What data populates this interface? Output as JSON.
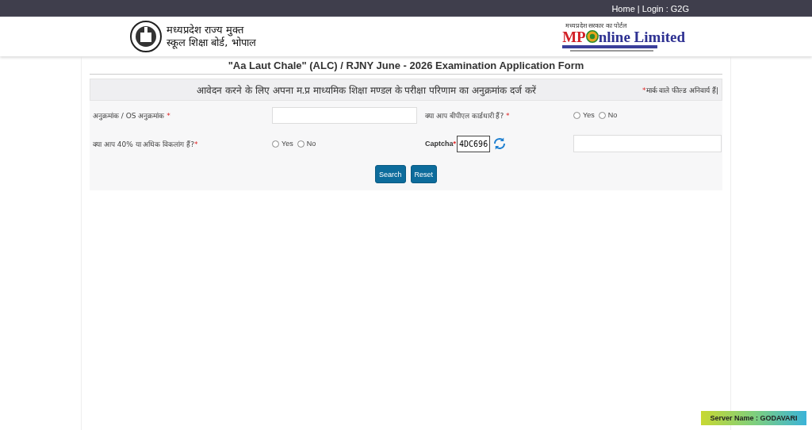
{
  "top_bar": {
    "links": [
      "Home |",
      "Login : G2G"
    ]
  },
  "header": {
    "board_name_line1": "मध्यप्रदेश राज्य मुक्त",
    "board_name_line2": "स्कूल शिक्षा बोर्ड, भोपाल",
    "portal_tagline": "मध्यप्रदेश सरकार का पोर्टल",
    "portal_name_start": "MP",
    "portal_name_end": "nline Limited"
  },
  "form": {
    "title": "\"Aa Laut Chale\" (ALC) / RJNY June - 2026 Examination Application Form",
    "instruction": "आवेदन करने के लिए अपना म.प्र माध्यमिक शिक्षा मण्डल के परीक्षा परिणाम का अनुक्रमांक दर्ज करें",
    "mandatory_note": "मार्क वाले फील्ड अनिवार्य हैं|",
    "roll_label": "अनुक्रमांक / OS अनुक्रमांक",
    "bpl_label": "क्या आप बीपीएल कार्डधारी हैं?",
    "bpl_options": [
      {
        "label": "Yes",
        "selected": false
      },
      {
        "label": "No",
        "selected": false
      }
    ],
    "disability_label": "क्या आप 40% या अधिक विकलांग हैं?",
    "disability_options": [
      {
        "label": "Yes",
        "selected": false
      },
      {
        "label": "No",
        "selected": false
      }
    ],
    "captcha_label": "Captcha",
    "captcha_code": "4DC696",
    "required_mark": "*",
    "buttons": [
      "Search",
      "Reset"
    ]
  },
  "server_badge": "Server Name : GODAVARI"
}
